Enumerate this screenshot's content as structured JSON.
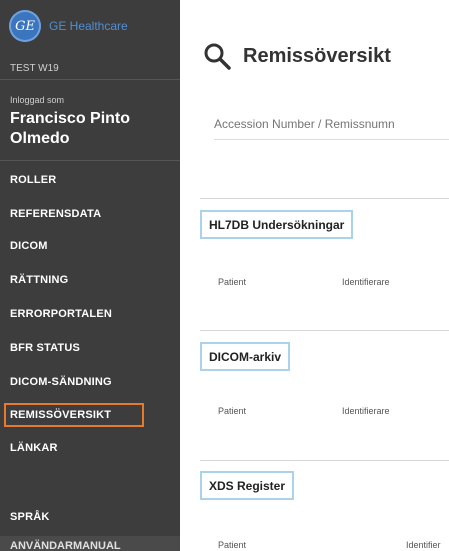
{
  "brand": {
    "logo_text": "GE",
    "name": "GE Healthcare"
  },
  "environment": "TEST W19",
  "login": {
    "label": "Inloggad som",
    "user_name": "Francisco Pinto Olmedo"
  },
  "nav": {
    "items": [
      {
        "label": "ROLLER"
      },
      {
        "label": "REFERENSDATA"
      },
      {
        "label": "DICOM"
      },
      {
        "label": "RÄTTNING"
      },
      {
        "label": "ERRORPORTALEN"
      },
      {
        "label": "BFR STATUS"
      },
      {
        "label": "DICOM-SÄNDNING"
      },
      {
        "label": "REMISSÖVERSIKT"
      },
      {
        "label": "LÄNKAR"
      },
      {
        "label": "SPRÅK"
      },
      {
        "label": "ANVÄNDARMANUAL"
      }
    ],
    "active_index": 7,
    "active_color": "#e67a2c"
  },
  "page": {
    "title": "Remissöversikt",
    "search_placeholder": "Accession Number / Remissnumn"
  },
  "sections": [
    {
      "title": "HL7DB Undersökningar",
      "columns": [
        "Patient",
        "Identifierare"
      ]
    },
    {
      "title": "DICOM-arkiv",
      "columns": [
        "Patient",
        "Identifierare"
      ]
    },
    {
      "title": "XDS Register",
      "columns": [
        "Patient",
        "Identifier"
      ]
    }
  ],
  "colors": {
    "sidebar_bg": "#3d3d3d",
    "section_highlight": "#a8d3e8",
    "brand_blue": "#3b75bd"
  }
}
